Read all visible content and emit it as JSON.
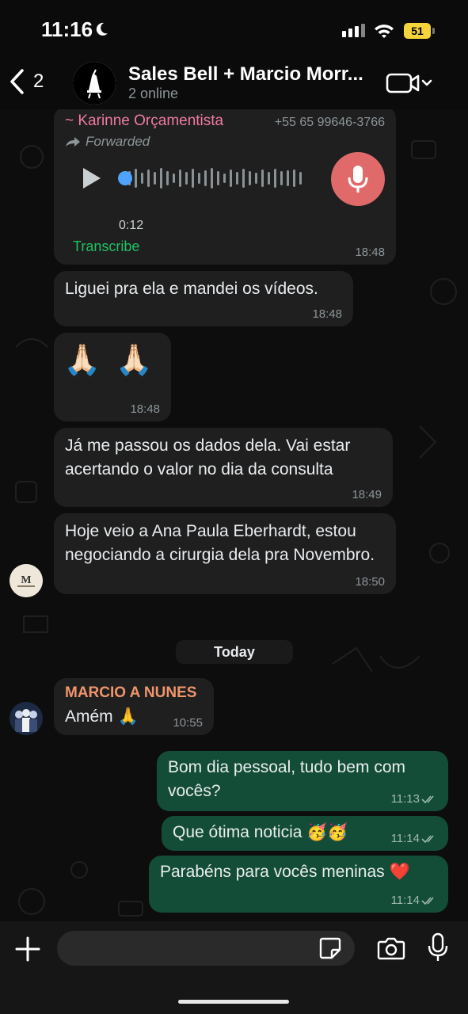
{
  "status_bar": {
    "time": "11:16",
    "battery": "51"
  },
  "header": {
    "back_count": "2",
    "title": "Sales Bell + Marcio Morr...",
    "subtitle": "2 online"
  },
  "messages": {
    "voice": {
      "sender": "~ Karinne Orçamentista",
      "phone": "+55 65 99646-3766",
      "forwarded": "Forwarded",
      "duration": "0:12",
      "transcribe": "Transcribe",
      "time": "18:48"
    },
    "m1": {
      "text": "Liguei pra ela e mandei os vídeos.",
      "time": "18:48"
    },
    "m2": {
      "text": "🙏🏻 🙏🏻",
      "time": "18:48"
    },
    "m3": {
      "text": "Já me passou os dados dela. Vai estar acertando o valor no dia da consulta",
      "time": "18:49"
    },
    "m4": {
      "text": "Hoje veio a Ana Paula Eberhardt, estou negociando a cirurgia dela pra Novembro.",
      "time": "18:50"
    },
    "date_divider": "Today",
    "m5": {
      "sender": "MARCIO A NUNES",
      "text": "Amém 🙏",
      "time": "10:55"
    },
    "m6": {
      "text": "Bom dia pessoal, tudo bem com vocês?",
      "time": "11:13"
    },
    "m7": {
      "text": "Que ótima noticia 🥳🥳",
      "time": "11:14"
    },
    "m8": {
      "text": "Parabéns para vocês meninas ❤️",
      "time": "11:14"
    }
  },
  "composer": {
    "placeholder": ""
  },
  "colors": {
    "outgoing_bubble": "#144d37",
    "incoming_bubble": "#1f1f1f",
    "mic_record": "#e06a6a",
    "transcribe_green": "#21c063",
    "karinne_pink": "#f07ba0",
    "marcio_orange": "#f0956a"
  },
  "icons": [
    "moon-icon",
    "signal-icon",
    "wifi-icon",
    "battery-icon",
    "chevron-left-icon",
    "video-call-icon",
    "play-icon",
    "mic-icon",
    "forward-arrow-icon",
    "plus-icon",
    "sticker-icon",
    "camera-icon"
  ]
}
